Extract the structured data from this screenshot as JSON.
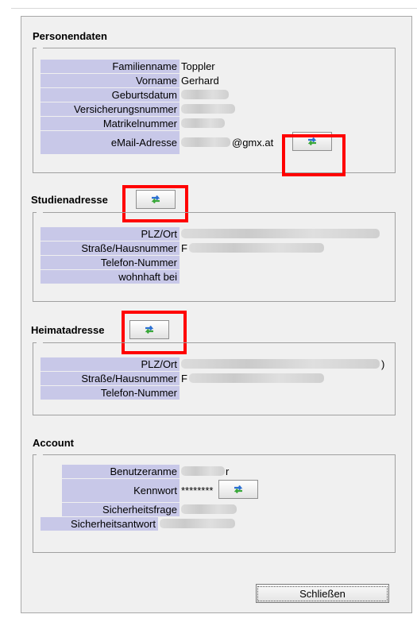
{
  "sections": {
    "personendaten": {
      "title": "Personendaten",
      "rows": [
        {
          "label": "Familienname",
          "value": "Toppler"
        },
        {
          "label": "Vorname",
          "value": "Gerhard"
        },
        {
          "label": "Geburtsdatum",
          "value": ""
        },
        {
          "label": "Versicherungsnummer",
          "value": ""
        },
        {
          "label": "Matrikelnummer",
          "value": ""
        },
        {
          "label": "eMail-Adresse",
          "value": "@gmx.at"
        }
      ]
    },
    "studienadresse": {
      "title": "Studienadresse",
      "rows": [
        {
          "label": "PLZ/Ort",
          "value": ""
        },
        {
          "label": "Straße/Hausnummer",
          "value": "F"
        },
        {
          "label": "Telefon-Nummer",
          "value": ""
        },
        {
          "label": "wohnhaft bei",
          "value": ""
        }
      ]
    },
    "heimatadresse": {
      "title": "Heimatadresse",
      "rows": [
        {
          "label": "PLZ/Ort",
          "value": ")"
        },
        {
          "label": "Straße/Hausnummer",
          "value": "F"
        },
        {
          "label": "Telefon-Nummer",
          "value": ""
        }
      ]
    },
    "account": {
      "title": "Account",
      "rows": [
        {
          "label": "Benutzeranme",
          "value": "r"
        },
        {
          "label": "Kennwort",
          "value": "********"
        },
        {
          "label": "Sicherheitsfrage",
          "value": ""
        },
        {
          "label": "Sicherheitsantwort",
          "value": ""
        }
      ]
    }
  },
  "close_button": {
    "label": "Schließen"
  },
  "icons": {
    "refresh": "refresh-arrows-icon"
  },
  "colors": {
    "label_bg": "#c8c8e8",
    "panel_bg": "#f0f0f0",
    "highlight": "#ff0000",
    "arrow_blue": "#2a6fd1",
    "arrow_green": "#3aa83a"
  }
}
